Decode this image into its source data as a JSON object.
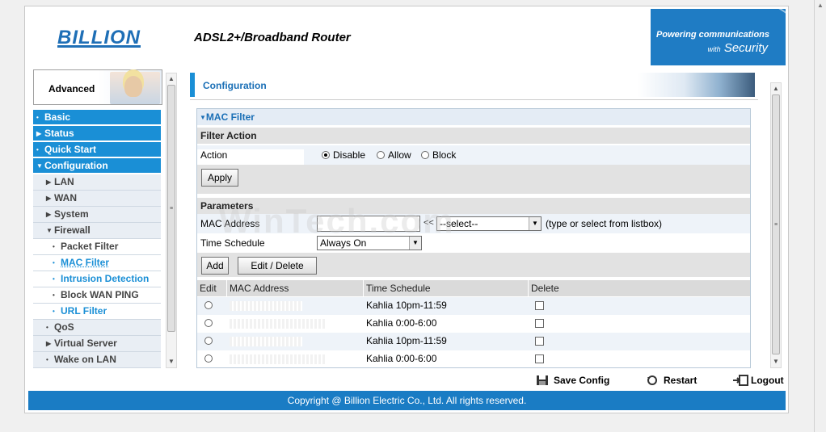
{
  "header": {
    "logo": "BILLION",
    "title": "ADSL2+/Broadband Router",
    "tagline_top": "Powering communications",
    "tagline_bottom_prefix": "with",
    "tagline_bottom": "Security"
  },
  "sidebar": {
    "advanced_label": "Advanced",
    "items": [
      {
        "label": "Basic",
        "level": 0,
        "icon": "dot"
      },
      {
        "label": "Status",
        "level": 0,
        "icon": "arrow-right"
      },
      {
        "label": "Quick Start",
        "level": 0,
        "icon": "dot"
      },
      {
        "label": "Configuration",
        "level": 0,
        "icon": "arrow-down"
      },
      {
        "label": "LAN",
        "level": 1,
        "icon": "arrow-right"
      },
      {
        "label": "WAN",
        "level": 1,
        "icon": "arrow-right"
      },
      {
        "label": "System",
        "level": 1,
        "icon": "arrow-right"
      },
      {
        "label": "Firewall",
        "level": 1,
        "icon": "arrow-down"
      },
      {
        "label": "Packet Filter",
        "level": 2,
        "icon": "dot"
      },
      {
        "label": "MAC Filter",
        "level": 2,
        "icon": "dot",
        "selected": true
      },
      {
        "label": "Intrusion Detection",
        "level": 2,
        "icon": "dot",
        "blue": true
      },
      {
        "label": "Block WAN PING",
        "level": 2,
        "icon": "dot"
      },
      {
        "label": "URL Filter",
        "level": 2,
        "icon": "dot",
        "blue": true
      },
      {
        "label": "QoS",
        "level": 1,
        "icon": "dot"
      },
      {
        "label": "Virtual Server",
        "level": 1,
        "icon": "arrow-right"
      },
      {
        "label": "Wake on LAN",
        "level": 1,
        "icon": "dot"
      }
    ]
  },
  "main": {
    "page_title": "Configuration",
    "section_title": "MAC Filter",
    "filter_action": {
      "heading": "Filter Action",
      "action_label": "Action",
      "options": [
        "Disable",
        "Allow",
        "Block"
      ],
      "selected": "Disable",
      "apply_label": "Apply"
    },
    "parameters": {
      "heading": "Parameters",
      "mac_label": "MAC Address",
      "mac_value": "",
      "arrow_text": "<<",
      "listbox_value": "--select--",
      "hint": "(type or select from listbox)",
      "schedule_label": "Time Schedule",
      "schedule_value": "Always On",
      "add_label": "Add",
      "edit_delete_label": "Edit / Delete"
    },
    "table": {
      "headers": [
        "Edit",
        "MAC Address",
        "Time Schedule",
        "Delete"
      ],
      "rows": [
        {
          "schedule": "Kahlia 10pm-11:59"
        },
        {
          "schedule": "Kahlia 0:00-6:00"
        },
        {
          "schedule": "Kahlia 10pm-11:59"
        },
        {
          "schedule": "Kahlia 0:00-6:00"
        }
      ]
    }
  },
  "actions": {
    "save": "Save Config",
    "restart": "Restart",
    "logout": "Logout"
  },
  "footer": {
    "copyright": "Copyright @ Billion Electric Co., Ltd. All rights reserved."
  },
  "colors": {
    "brand_blue": "#1a8fd6",
    "header_blue": "#1f7cc4"
  }
}
